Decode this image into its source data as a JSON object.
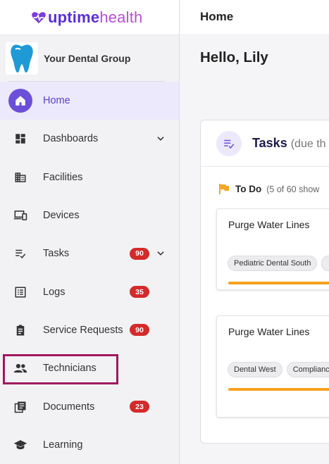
{
  "brand": {
    "name_bold": "uptime",
    "name_light": "health"
  },
  "org": {
    "name": "Your Dental Group"
  },
  "sidebar": {
    "items": [
      {
        "label": "Home",
        "icon": "home-icon",
        "active": true
      },
      {
        "label": "Dashboards",
        "icon": "dashboard-icon",
        "expandable": true
      },
      {
        "label": "Facilities",
        "icon": "building-icon"
      },
      {
        "label": "Devices",
        "icon": "devices-icon"
      },
      {
        "label": "Tasks",
        "icon": "tasks-icon",
        "badge": "90",
        "expandable": true
      },
      {
        "label": "Logs",
        "icon": "list-icon",
        "badge": "35"
      },
      {
        "label": "Service Requests",
        "icon": "clipboard-icon",
        "badge": "90"
      },
      {
        "label": "Technicians",
        "icon": "people-icon",
        "highlighted": true
      },
      {
        "label": "Documents",
        "icon": "documents-icon",
        "badge": "23"
      },
      {
        "label": "Learning",
        "icon": "school-icon"
      }
    ]
  },
  "header": {
    "title": "Home"
  },
  "main": {
    "greeting": "Hello, Lily",
    "tasks_card": {
      "title": "Tasks",
      "subtitle": "(due th",
      "todo_label": "To Do",
      "todo_count": "(5 of 60 show",
      "tasks": [
        {
          "title": "Purge Water Lines",
          "chips": [
            "Pediatric Dental South",
            ""
          ]
        },
        {
          "title": "Purge Water Lines",
          "chips": [
            "Dental West",
            "Complianc"
          ]
        }
      ]
    }
  },
  "colors": {
    "accent": "#6c4fd9",
    "badge": "#d52a2a",
    "highlight_box": "#a0195f",
    "progress": "#f5a11e",
    "flag": "#f5a623"
  }
}
